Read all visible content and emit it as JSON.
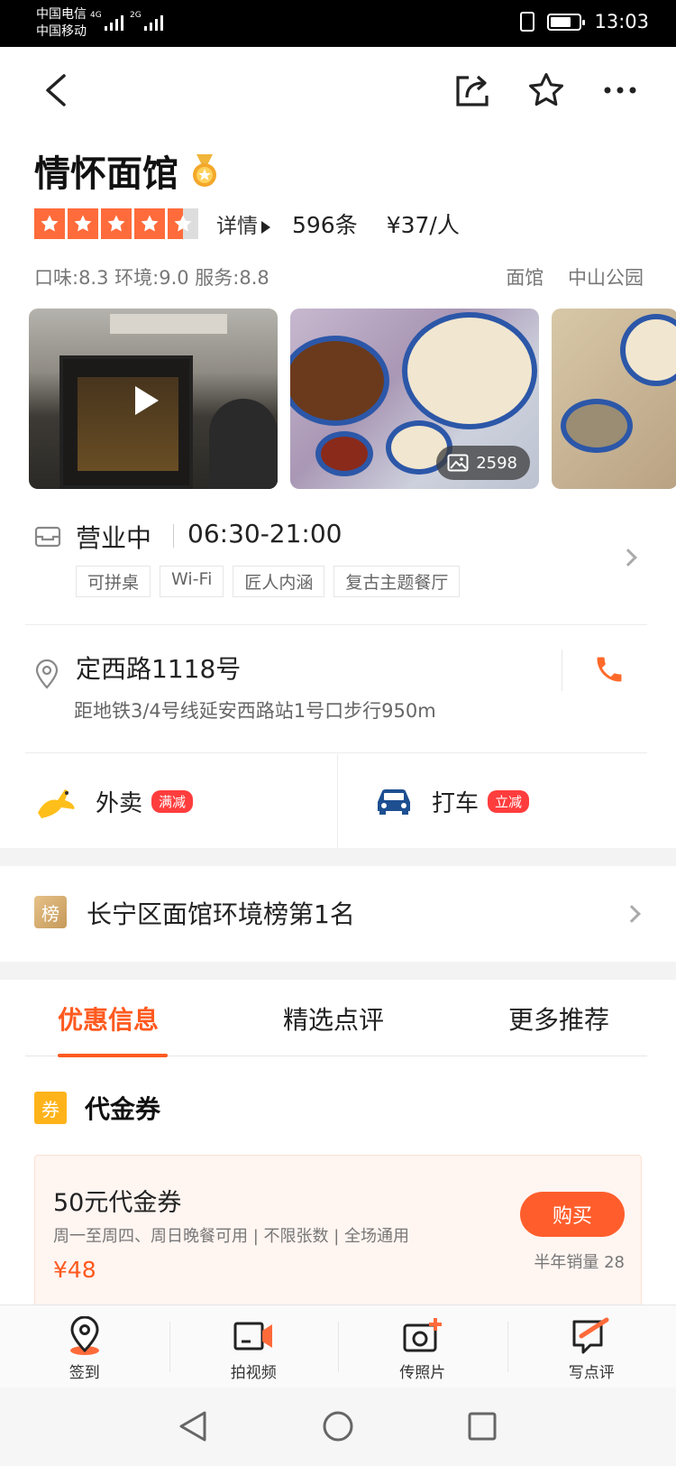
{
  "status_bar": {
    "carrier_1": "中国电信",
    "carrier_2": "中国移动",
    "net_1": "4G",
    "net_2": "2G",
    "time": "13:03"
  },
  "nav": {
    "back_icon": "chevron-left-icon",
    "share_icon": "share-icon",
    "favorite_icon": "star-outline-icon",
    "more_icon": "more-icon"
  },
  "shop": {
    "name": "情怀面馆",
    "medal_icon": "gold-medal-icon",
    "stars": 4.5,
    "detail_label": "详情",
    "review_count": "596条",
    "price_per_person": "¥37/人",
    "scores": "口味:8.3 环境:9.0 服务:8.8",
    "category": "面馆",
    "area": "中山公园"
  },
  "photos": {
    "count": "2598"
  },
  "hours": {
    "status": "营业中",
    "time": "06:30-21:00",
    "tags": [
      "可拼桌",
      "Wi-Fi",
      "匠人内涵",
      "复古主题餐厅"
    ]
  },
  "address": {
    "street": "定西路1118号",
    "subway": "距地铁3/4号线延安西路站1号口步行950m"
  },
  "services": {
    "delivery_label": "外卖",
    "delivery_badge": "满减",
    "taxi_label": "打车",
    "taxi_badge": "立减"
  },
  "ranking": {
    "icon_text": "榜",
    "label": "长宁区面馆环境榜第1名"
  },
  "tabs": [
    "优惠信息",
    "精选点评",
    "更多推荐"
  ],
  "section": {
    "icon_text": "券",
    "title": "代金券"
  },
  "voucher": {
    "title": "50元代金券",
    "desc": "周一至周四、周日晚餐可用 | 不限张数 | 全场通用",
    "price": "¥48",
    "buy_label": "购买",
    "sales": "半年销量 28"
  },
  "bottom_bar": [
    {
      "label": "签到",
      "icon": "location-pin-icon"
    },
    {
      "label": "拍视频",
      "icon": "video-camera-icon"
    },
    {
      "label": "传照片",
      "icon": "photo-upload-icon"
    },
    {
      "label": "写点评",
      "icon": "write-review-icon"
    }
  ],
  "colors": {
    "accent": "#ff5a1f",
    "star": "#ff6b3b",
    "badge_red": "#ff3d3d"
  }
}
